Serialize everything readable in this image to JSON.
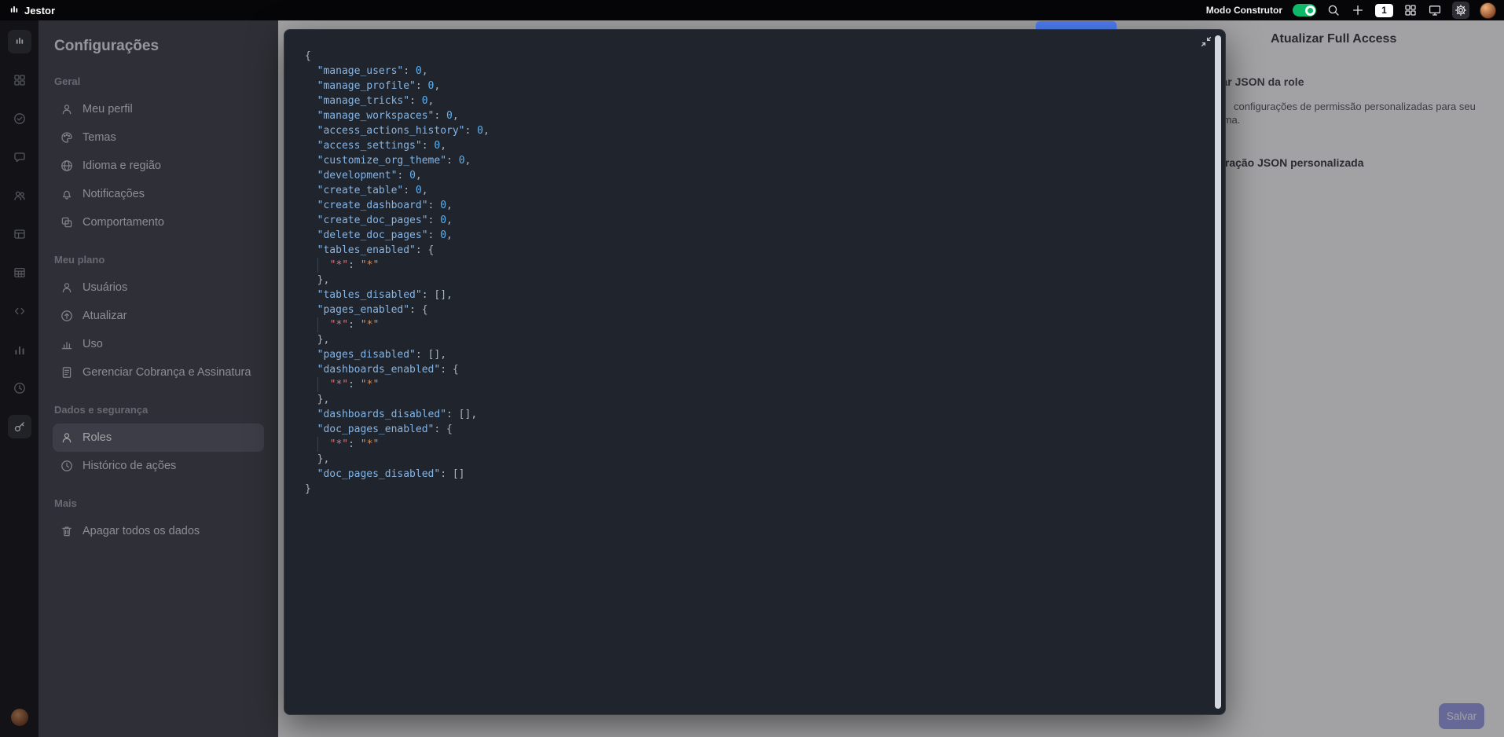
{
  "topbar": {
    "logo_text": "Jestor",
    "mode_label": "Modo Construtor",
    "toggle_on": true,
    "badge_count": "1"
  },
  "iconbar": {
    "items": [
      {
        "icon": "jestor-logo-icon",
        "active": true
      },
      {
        "icon": "apps-icon",
        "active": false
      },
      {
        "icon": "check-circle-icon",
        "active": false
      },
      {
        "icon": "chat-icon",
        "active": false
      },
      {
        "icon": "users-icon",
        "active": false
      },
      {
        "icon": "cards-icon",
        "active": false
      },
      {
        "icon": "table-icon",
        "active": false
      },
      {
        "icon": "code-icon",
        "active": false
      },
      {
        "icon": "chart-icon",
        "active": false
      },
      {
        "icon": "clock-icon",
        "active": false
      },
      {
        "icon": "key-icon",
        "active": true
      }
    ]
  },
  "settings_nav": {
    "title": "Configurações",
    "sections": [
      {
        "label": "Geral",
        "items": [
          {
            "label": "Meu perfil",
            "icon": "user-icon",
            "active": false
          },
          {
            "label": "Temas",
            "icon": "palette-icon",
            "active": false
          },
          {
            "label": "Idioma e região",
            "icon": "language-icon",
            "active": false
          },
          {
            "label": "Notificações",
            "icon": "bell-icon",
            "active": false
          },
          {
            "label": "Comportamento",
            "icon": "behavior-icon",
            "active": false
          }
        ]
      },
      {
        "label": "Meu plano",
        "items": [
          {
            "label": "Usuários",
            "icon": "user-icon",
            "active": false
          },
          {
            "label": "Atualizar",
            "icon": "upgrade-icon",
            "active": false
          },
          {
            "label": "Uso",
            "icon": "usage-icon",
            "active": false
          },
          {
            "label": "Gerenciar Cobrança e Assinatura",
            "icon": "billing-icon",
            "active": false
          }
        ]
      },
      {
        "label": "Dados e segurança",
        "items": [
          {
            "label": "Roles",
            "icon": "user-icon",
            "active": true
          },
          {
            "label": "Histórico de ações",
            "icon": "history-icon",
            "active": false
          }
        ]
      },
      {
        "label": "Mais",
        "items": [
          {
            "label": "Apagar todos os dados",
            "icon": "trash-icon",
            "active": false
          }
        ]
      }
    ]
  },
  "dialog": {
    "title": "Atualizar Full Access",
    "section_label": "Editar JSON da role",
    "description": "configurações de permissão personalizadas para seu sistema.",
    "field_label": "Configuração JSON personalizada",
    "save_label": "Salvar"
  },
  "colors": {
    "accent_green": "#0fb768",
    "editor_background": "#20242c",
    "save_button": "#9fa4ea",
    "json_key": "#85b5e6",
    "json_number": "#5fb2f2",
    "json_star_key": "#d8757c",
    "json_star_value": "#d79058"
  },
  "editor": {
    "lines": [
      [
        [
          "p",
          "{"
        ]
      ],
      [
        [
          "p",
          "  "
        ],
        [
          "k",
          "\"manage_users\""
        ],
        [
          "p",
          ": "
        ],
        [
          "n",
          "0"
        ],
        [
          "p",
          ","
        ]
      ],
      [
        [
          "p",
          "  "
        ],
        [
          "k",
          "\"manage_profile\""
        ],
        [
          "p",
          ": "
        ],
        [
          "n",
          "0"
        ],
        [
          "p",
          ","
        ]
      ],
      [
        [
          "p",
          "  "
        ],
        [
          "k",
          "\"manage_tricks\""
        ],
        [
          "p",
          ": "
        ],
        [
          "n",
          "0"
        ],
        [
          "p",
          ","
        ]
      ],
      [
        [
          "p",
          "  "
        ],
        [
          "k",
          "\"manage_workspaces\""
        ],
        [
          "p",
          ": "
        ],
        [
          "n",
          "0"
        ],
        [
          "p",
          ","
        ]
      ],
      [
        [
          "p",
          "  "
        ],
        [
          "k",
          "\"access_actions_history\""
        ],
        [
          "p",
          ": "
        ],
        [
          "n",
          "0"
        ],
        [
          "p",
          ","
        ]
      ],
      [
        [
          "p",
          "  "
        ],
        [
          "k",
          "\"access_settings\""
        ],
        [
          "p",
          ": "
        ],
        [
          "n",
          "0"
        ],
        [
          "p",
          ","
        ]
      ],
      [
        [
          "p",
          "  "
        ],
        [
          "k",
          "\"customize_org_theme\""
        ],
        [
          "p",
          ": "
        ],
        [
          "n",
          "0"
        ],
        [
          "p",
          ","
        ]
      ],
      [
        [
          "p",
          "  "
        ],
        [
          "k",
          "\"development\""
        ],
        [
          "p",
          ": "
        ],
        [
          "n",
          "0"
        ],
        [
          "p",
          ","
        ]
      ],
      [
        [
          "p",
          "  "
        ],
        [
          "k",
          "\"create_table\""
        ],
        [
          "p",
          ": "
        ],
        [
          "n",
          "0"
        ],
        [
          "p",
          ","
        ]
      ],
      [
        [
          "p",
          "  "
        ],
        [
          "k",
          "\"create_dashboard\""
        ],
        [
          "p",
          ": "
        ],
        [
          "n",
          "0"
        ],
        [
          "p",
          ","
        ]
      ],
      [
        [
          "p",
          "  "
        ],
        [
          "k",
          "\"create_doc_pages\""
        ],
        [
          "p",
          ": "
        ],
        [
          "n",
          "0"
        ],
        [
          "p",
          ","
        ]
      ],
      [
        [
          "p",
          "  "
        ],
        [
          "k",
          "\"delete_doc_pages\""
        ],
        [
          "p",
          ": "
        ],
        [
          "n",
          "0"
        ],
        [
          "p",
          ","
        ]
      ],
      [
        [
          "p",
          "  "
        ],
        [
          "k",
          "\"tables_enabled\""
        ],
        [
          "p",
          ": {"
        ]
      ],
      [
        [
          "p",
          "  "
        ],
        [
          "g",
          ""
        ],
        [
          "sk",
          "\"*\""
        ],
        [
          "p",
          ": "
        ],
        [
          "s",
          "\"*\""
        ]
      ],
      [
        [
          "p",
          "  },"
        ]
      ],
      [
        [
          "p",
          "  "
        ],
        [
          "k",
          "\"tables_disabled\""
        ],
        [
          "p",
          ": [],"
        ]
      ],
      [
        [
          "p",
          "  "
        ],
        [
          "k",
          "\"pages_enabled\""
        ],
        [
          "p",
          ": {"
        ]
      ],
      [
        [
          "p",
          "  "
        ],
        [
          "g",
          ""
        ],
        [
          "sk",
          "\"*\""
        ],
        [
          "p",
          ": "
        ],
        [
          "s",
          "\"*\""
        ]
      ],
      [
        [
          "p",
          "  },"
        ]
      ],
      [
        [
          "p",
          "  "
        ],
        [
          "k",
          "\"pages_disabled\""
        ],
        [
          "p",
          ": [],"
        ]
      ],
      [
        [
          "p",
          "  "
        ],
        [
          "k",
          "\"dashboards_enabled\""
        ],
        [
          "p",
          ": {"
        ]
      ],
      [
        [
          "p",
          "  "
        ],
        [
          "g",
          ""
        ],
        [
          "sk",
          "\"*\""
        ],
        [
          "p",
          ": "
        ],
        [
          "s",
          "\"*\""
        ]
      ],
      [
        [
          "p",
          "  },"
        ]
      ],
      [
        [
          "p",
          "  "
        ],
        [
          "k",
          "\"dashboards_disabled\""
        ],
        [
          "p",
          ": [],"
        ]
      ],
      [
        [
          "p",
          "  "
        ],
        [
          "k",
          "\"doc_pages_enabled\""
        ],
        [
          "p",
          ": {"
        ]
      ],
      [
        [
          "p",
          "  "
        ],
        [
          "g",
          ""
        ],
        [
          "sk",
          "\"*\""
        ],
        [
          "p",
          ": "
        ],
        [
          "s",
          "\"*\""
        ]
      ],
      [
        [
          "p",
          "  },"
        ]
      ],
      [
        [
          "p",
          "  "
        ],
        [
          "k",
          "\"doc_pages_disabled\""
        ],
        [
          "p",
          ": []"
        ]
      ],
      [
        [
          "p",
          "}"
        ]
      ]
    ]
  }
}
